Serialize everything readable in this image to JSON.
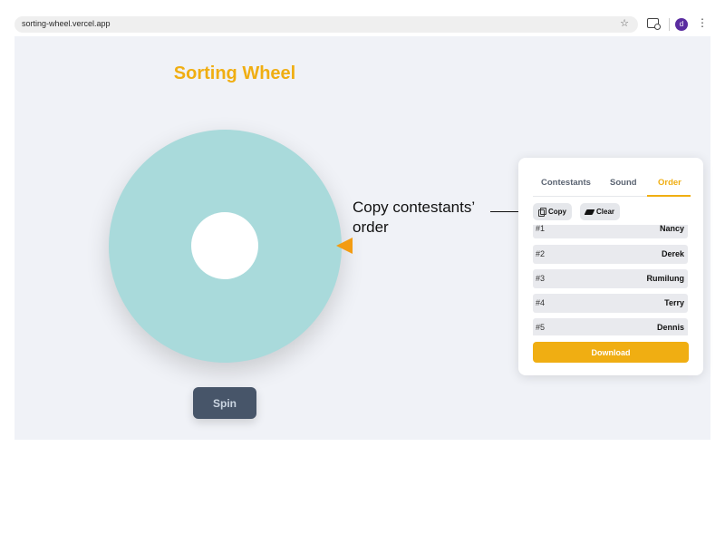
{
  "browser": {
    "url": "sorting-wheel.vercel.app",
    "avatar_letter": "d",
    "menu_glyph": "⋮",
    "star_glyph": "☆"
  },
  "page": {
    "title": "Sorting Wheel",
    "spin_label": "Spin"
  },
  "annotation": {
    "line1": "Copy contestants’",
    "line2": "order"
  },
  "panel": {
    "tabs": [
      {
        "label": "Contestants",
        "active": false
      },
      {
        "label": "Sound",
        "active": false
      },
      {
        "label": "Order",
        "active": true
      }
    ],
    "copy_label": "Copy",
    "clear_label": "Clear",
    "order": [
      {
        "rank": "#1",
        "name": "Nancy"
      },
      {
        "rank": "#2",
        "name": "Derek"
      },
      {
        "rank": "#3",
        "name": "Rumilung"
      },
      {
        "rank": "#4",
        "name": "Terry"
      },
      {
        "rank": "#5",
        "name": "Dennis"
      }
    ],
    "download_label": "Download"
  },
  "colors": {
    "accent": "#f0ae12",
    "wheel": "#a9dadb",
    "pointer": "#f39c12",
    "spin_button": "#475569",
    "page_background": "#f0f2f7"
  }
}
